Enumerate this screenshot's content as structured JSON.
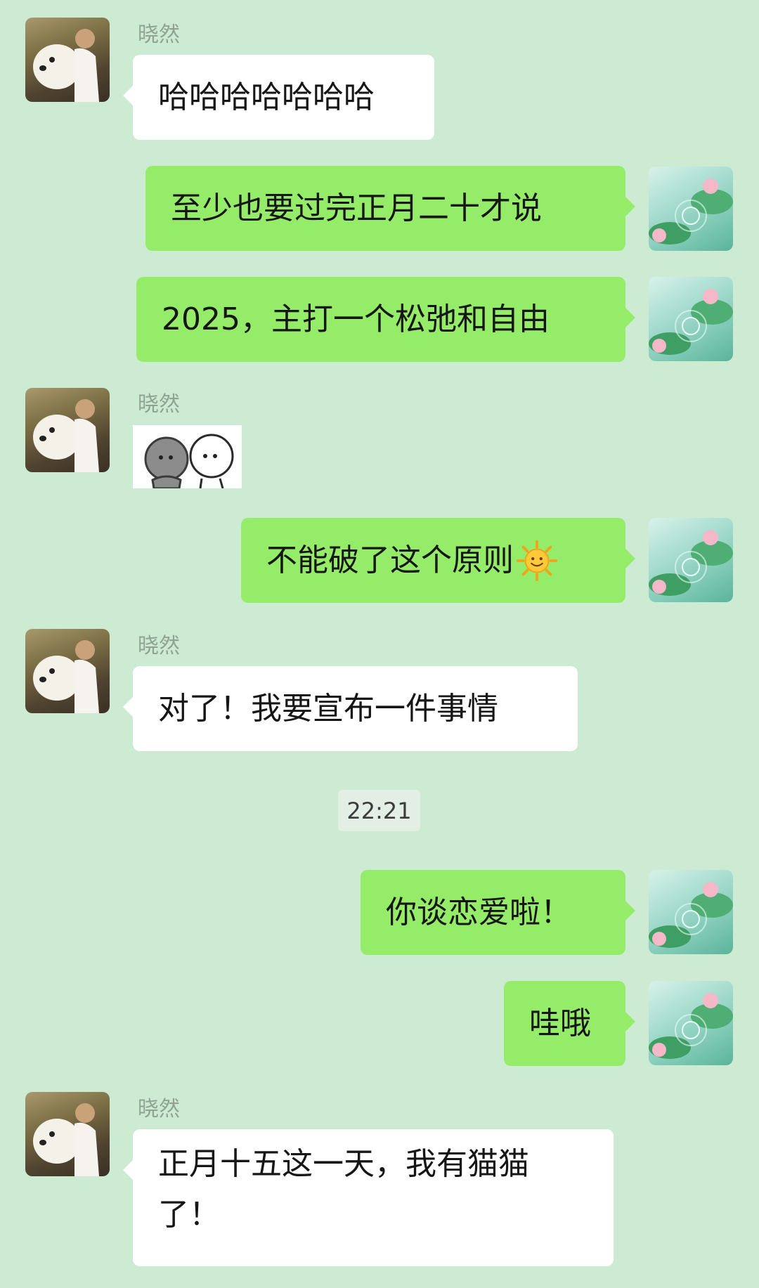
{
  "contact": {
    "name": "晓然"
  },
  "messages": [
    {
      "side": "in",
      "type": "text",
      "sender": "晓然",
      "text": "哈哈哈哈哈哈哈"
    },
    {
      "side": "out",
      "type": "text",
      "text": "至少也要过完正月二十才说"
    },
    {
      "side": "out",
      "type": "text",
      "text": "2025，主打一个松弛和自由"
    },
    {
      "side": "in",
      "type": "sticker",
      "sender": "晓然",
      "sticker": "two-figures-sticker"
    },
    {
      "side": "out",
      "type": "text",
      "text": "不能破了这个原则",
      "emoji": "sun-emoji"
    },
    {
      "side": "in",
      "type": "text",
      "sender": "晓然",
      "text": "对了！我要宣布一件事情"
    },
    {
      "type": "time",
      "text": "22:21"
    },
    {
      "side": "out",
      "type": "text",
      "text": "你谈恋爱啦！"
    },
    {
      "side": "out",
      "type": "text",
      "text": "哇哦"
    },
    {
      "side": "in",
      "type": "text",
      "sender": "晓然",
      "text": "正月十五这一天，我有猫猫了！"
    }
  ],
  "colors": {
    "background": "#cdebd3",
    "incoming_bubble": "#ffffff",
    "outgoing_bubble": "#95ec69",
    "sender_name": "#8fa393"
  }
}
